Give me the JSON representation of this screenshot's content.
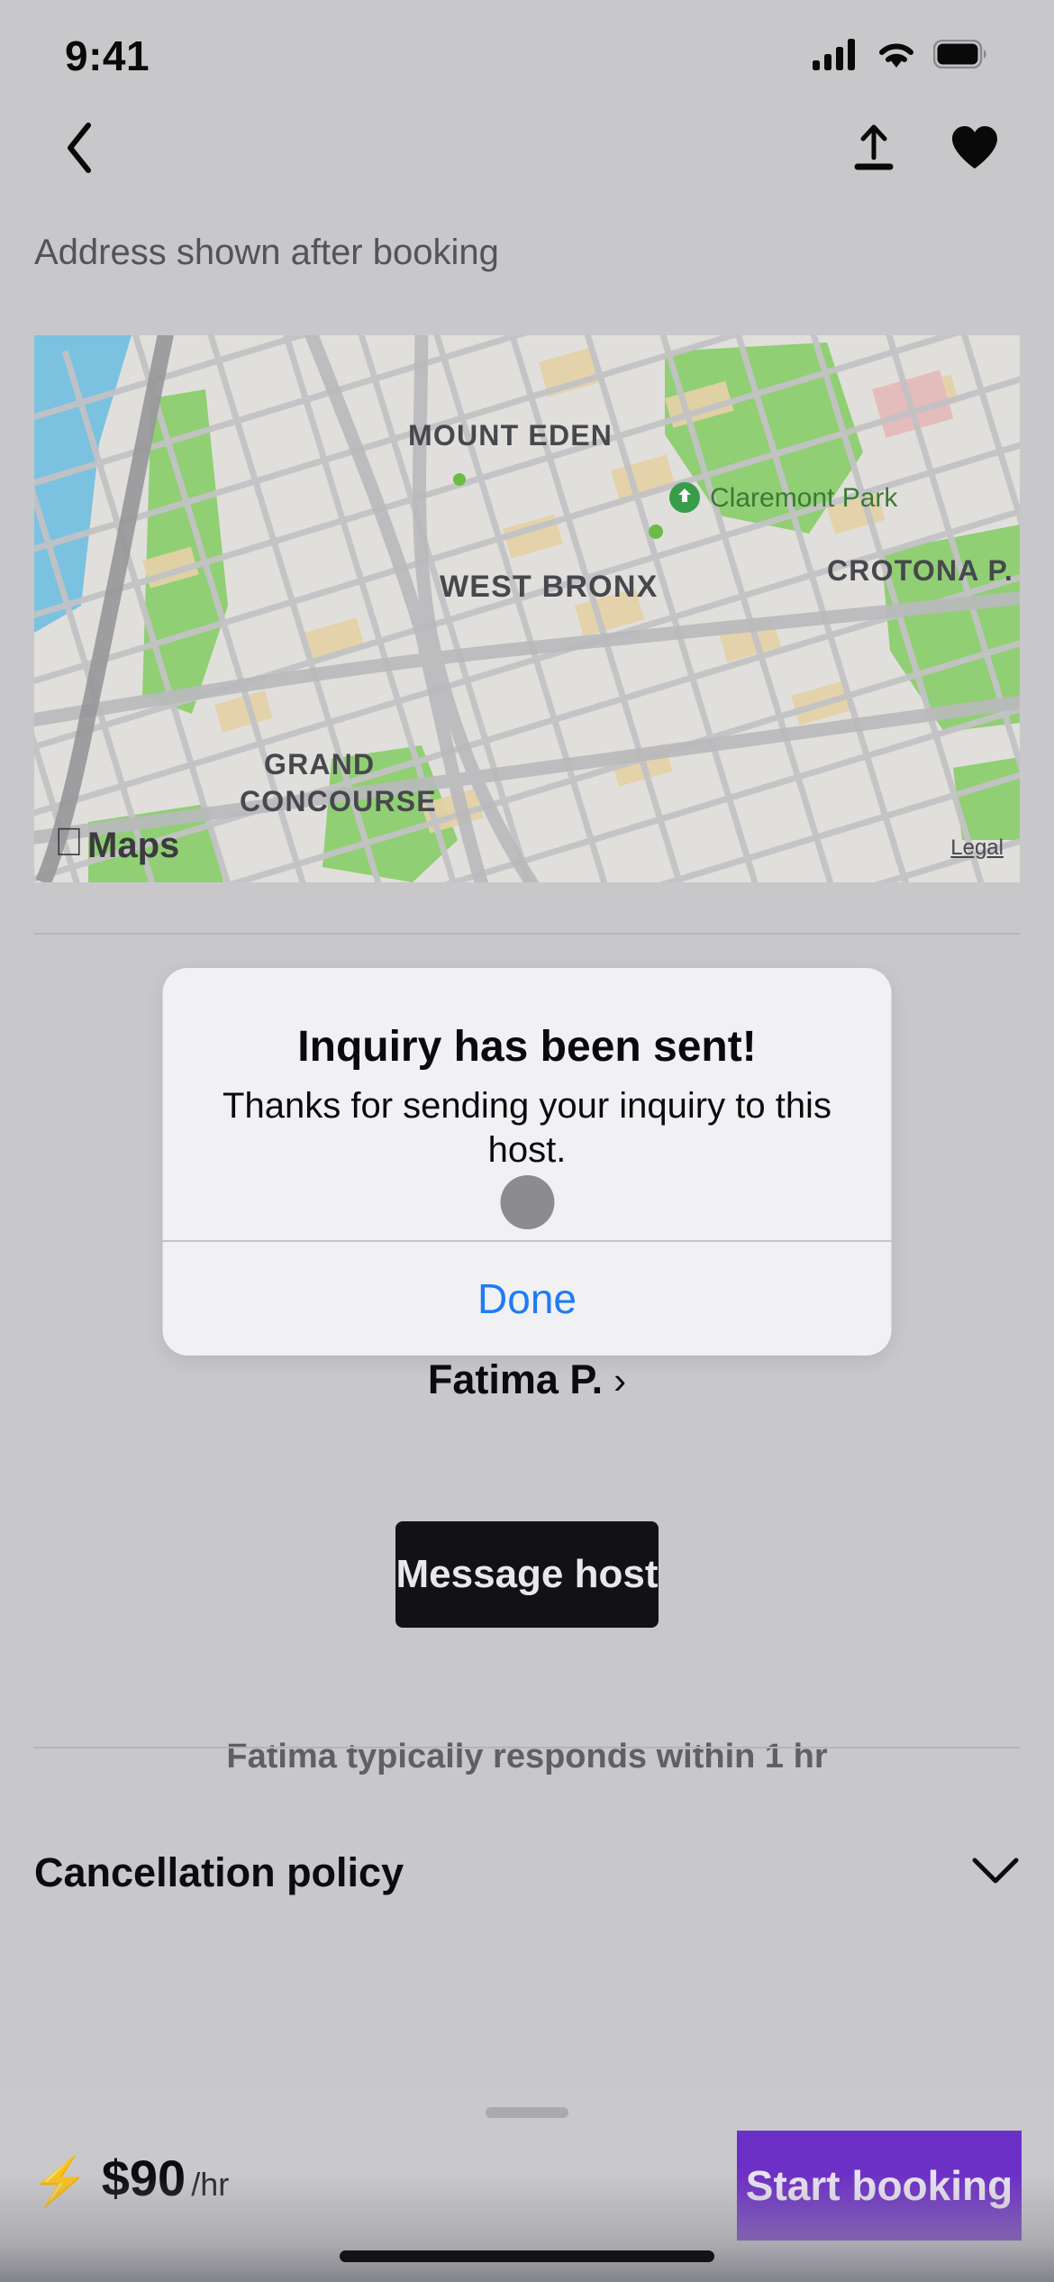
{
  "status_bar": {
    "time": "9:41",
    "icons": [
      "cellular-signal-icon",
      "wifi-icon",
      "battery-icon"
    ]
  },
  "nav_bar": {
    "back_icon": "chevron-left-icon",
    "share_icon": "share-upload-icon",
    "favorite_icon": "heart-filled-icon"
  },
  "listing": {
    "address_note": "Address shown after booking",
    "map": {
      "attribution": "Maps",
      "legal_link": "Legal",
      "labels": [
        "MOUNT EDEN",
        "Claremont Park",
        "WEST BRONX",
        "CROTONA P.",
        "GRAND",
        "CONCOURSE"
      ],
      "poi_marker": "park-pin-icon"
    },
    "host": {
      "name": "Fatima P.",
      "chevron": "›",
      "message_button": "Message host",
      "response_note": "Fatima typically responds within 1 hr"
    },
    "cancellation": {
      "title": "Cancellation policy",
      "chevron_icon": "chevron-down-icon"
    }
  },
  "alert": {
    "title": "Inquiry has been sent!",
    "message": "Thanks for sending your inquiry to this host.",
    "action_label": "Done"
  },
  "booking_bar": {
    "bolt_icon": "lightning-bolt-icon",
    "price": "$90",
    "price_unit": "/hr",
    "cta_label": "Start booking",
    "cta_color": "#7132cd"
  }
}
